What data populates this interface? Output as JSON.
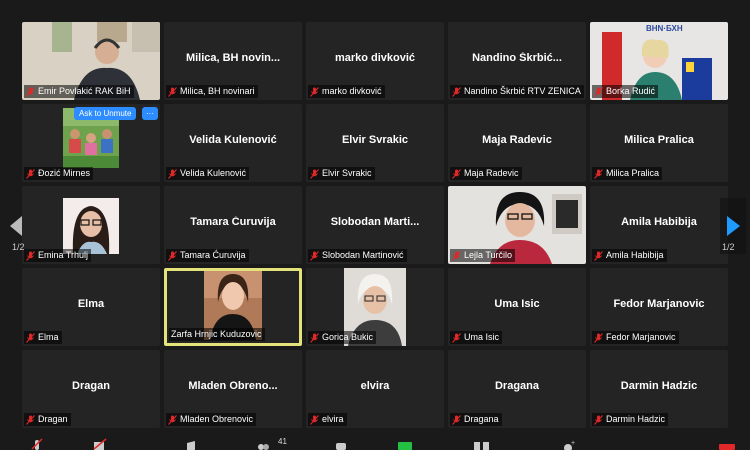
{
  "pager": {
    "left_page": "1/2",
    "right_page": "1/2"
  },
  "ask_to_unmute": "Ask to Unmute",
  "more_options": "···",
  "toolbar": {
    "participants_count": "41"
  },
  "colors": {
    "active_speaker_border": "#e4e27a",
    "accent_blue": "#2d8cff",
    "mic_off_red": "#e02828"
  },
  "tiles": [
    {
      "label": "Emir Povlakić RAK BiH",
      "center": "",
      "video": "man-with-headset"
    },
    {
      "label": "Milica, BH novinari",
      "center": "Milica,  BH novin...",
      "video": ""
    },
    {
      "label": "marko divković",
      "center": "marko divković",
      "video": ""
    },
    {
      "label": "Nandino Škrbić RTV ZENICA",
      "center": "Nandino  Škrbić...",
      "video": ""
    },
    {
      "label": "Borka Rudić",
      "center": "",
      "video": "woman-with-flags"
    },
    {
      "label": "Đozić Mirnes",
      "center": "",
      "video": "family-photo"
    },
    {
      "label": "Velida Kulenović",
      "center": "Velida Kulenović",
      "video": ""
    },
    {
      "label": "Elvir Svrakic",
      "center": "Elvir Svrakic",
      "video": ""
    },
    {
      "label": "Maja Radevic",
      "center": "Maja Radevic",
      "video": ""
    },
    {
      "label": "Milica Pralica",
      "center": "Milica Pralica",
      "video": ""
    },
    {
      "label": "Emina Trhulj",
      "center": "",
      "video": "woman-with-glasses"
    },
    {
      "label": "Tamara Ćuruvija",
      "center": "Tamara Ćuruvija",
      "video": ""
    },
    {
      "label": "Slobodan Martinović",
      "center": "Slobodan  Marti...",
      "video": ""
    },
    {
      "label": "Lejla Turčilo",
      "center": "",
      "video": "woman-in-office"
    },
    {
      "label": "Amila Habibija",
      "center": "Amila Habibija",
      "video": ""
    },
    {
      "label": "Elma",
      "center": "Elma",
      "video": ""
    },
    {
      "label": "Zarfa Hrnjic Kuduzovic",
      "center": "",
      "video": "woman-speaking"
    },
    {
      "label": "Gorica Bukic",
      "center": "",
      "video": "woman-white-hair"
    },
    {
      "label": "Uma Isic",
      "center": "Uma Isic",
      "video": ""
    },
    {
      "label": "Fedor Marjanovic",
      "center": "Fedor Marjanovic",
      "video": ""
    },
    {
      "label": "Dragan",
      "center": "Dragan",
      "video": ""
    },
    {
      "label": "Mladen Obrenovic",
      "center": "Mladen  Obreno...",
      "video": ""
    },
    {
      "label": "elvira",
      "center": "elvira",
      "video": ""
    },
    {
      "label": "Dragana",
      "center": "Dragana",
      "video": ""
    },
    {
      "label": "Darmin Hadzic",
      "center": "Darmin Hadzic",
      "video": ""
    }
  ]
}
